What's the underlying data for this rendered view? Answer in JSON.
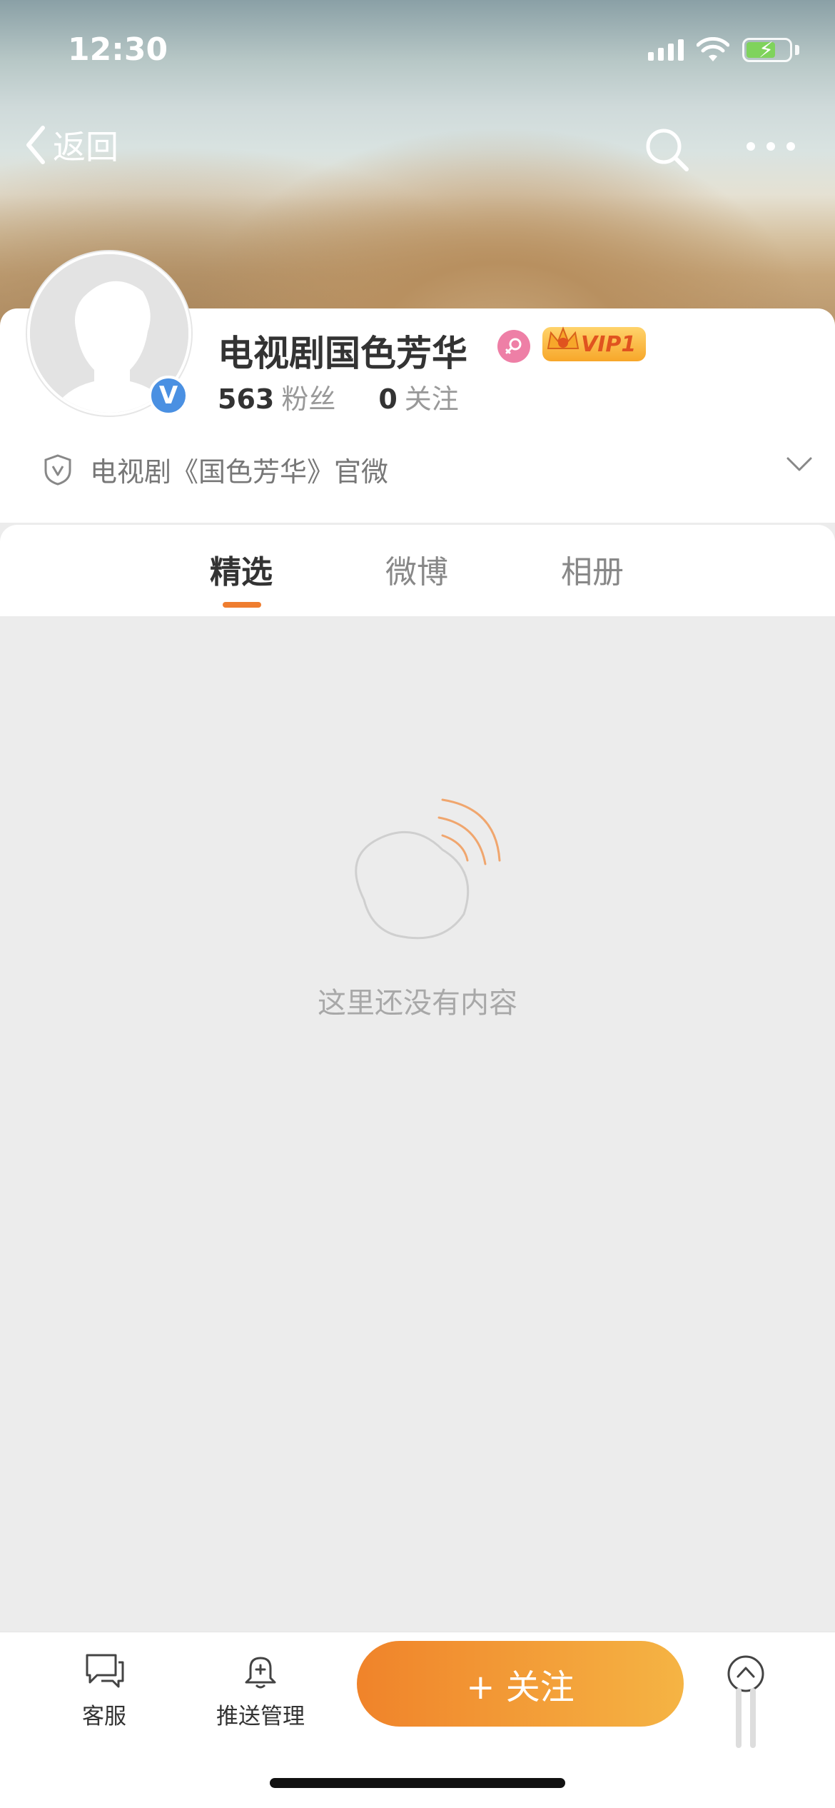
{
  "status_bar": {
    "time": "12:30"
  },
  "nav": {
    "back_label": "返回"
  },
  "profile": {
    "name": "电视剧国色芳华",
    "vip_label": "VIP1",
    "fans_count": "563",
    "fans_label": "粉丝",
    "following_count": "0",
    "following_label": "关注",
    "description": "电视剧《国色芳华》官微",
    "verified": true,
    "gender": "female"
  },
  "tabs": [
    {
      "label": "精选",
      "active": true
    },
    {
      "label": "微博",
      "active": false
    },
    {
      "label": "相册",
      "active": false
    }
  ],
  "empty_state": {
    "message": "这里还没有内容"
  },
  "bottom_bar": {
    "customer_service_label": "客服",
    "push_manage_label": "推送管理",
    "follow_button_label": "+ 关注"
  },
  "colors": {
    "accent_orange": "#ef7d2f",
    "verified_blue": "#4a90e2",
    "gender_pink": "#ee7fa6"
  }
}
